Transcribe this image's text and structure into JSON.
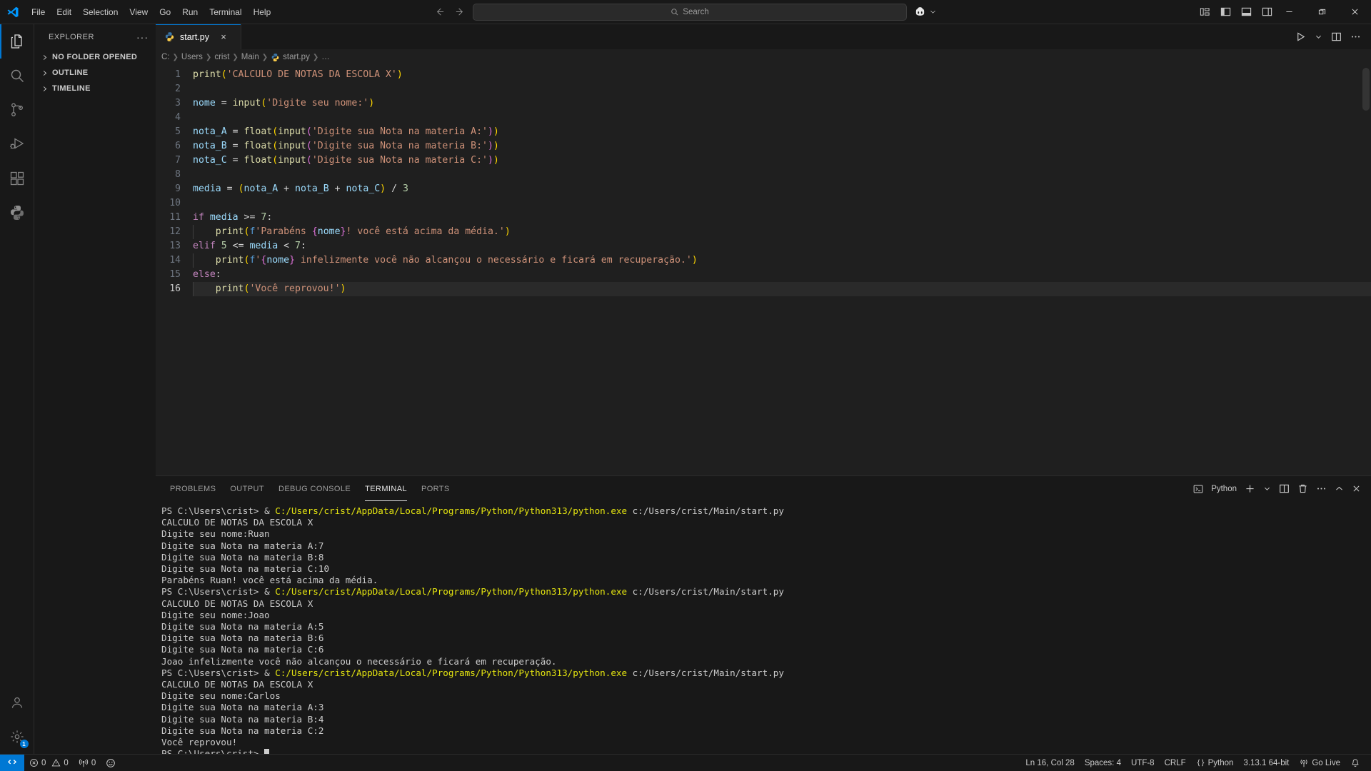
{
  "titlebar": {
    "menus": [
      "File",
      "Edit",
      "Selection",
      "View",
      "Go",
      "Run",
      "Terminal",
      "Help"
    ],
    "search_placeholder": "Search",
    "search_icon": "search-icon",
    "back_icon": "back-arrow-icon",
    "forward_icon": "forward-arrow-icon",
    "copilot_icon": "copilot-icon",
    "layout_icons": [
      "customize-layout-icon",
      "toggle-primary-sidebar-icon",
      "toggle-panel-icon",
      "toggle-secondary-sidebar-icon"
    ],
    "window_controls": [
      "minimize",
      "restore",
      "close"
    ]
  },
  "activitybar": {
    "items": [
      {
        "name": "explorer",
        "icon": "files-icon",
        "active": true
      },
      {
        "name": "search",
        "icon": "search-icon",
        "active": false
      },
      {
        "name": "source-control",
        "icon": "source-control-icon",
        "active": false
      },
      {
        "name": "run-and-debug",
        "icon": "run-debug-icon",
        "active": false
      },
      {
        "name": "extensions",
        "icon": "extensions-icon",
        "active": false
      },
      {
        "name": "python",
        "icon": "python-icon",
        "active": false
      }
    ],
    "bottom": [
      {
        "name": "accounts",
        "icon": "account-icon",
        "badge": null
      },
      {
        "name": "manage",
        "icon": "gear-icon",
        "badge": "1"
      }
    ]
  },
  "sidebar": {
    "title": "EXPLORER",
    "more_label": "···",
    "sections": [
      "NO FOLDER OPENED",
      "OUTLINE",
      "TIMELINE"
    ]
  },
  "editor": {
    "tab": {
      "label": "start.py",
      "icon": "python-file-icon",
      "close": "×"
    },
    "actions": [
      "run-python-file-icon",
      "chevron-down-icon",
      "split-editor-icon",
      "more-actions-icon"
    ],
    "breadcrumb": [
      "C:",
      "Users",
      "crist",
      "Main",
      "start.py",
      "…"
    ],
    "breadcrumb_file_icon": "python-file-icon",
    "cursor_line": 16,
    "lines": [
      {
        "n": 1,
        "text": "print('CALCULO DE NOTAS DA ESCOLA X')"
      },
      {
        "n": 2,
        "text": ""
      },
      {
        "n": 3,
        "text": "nome = input('Digite seu nome:')"
      },
      {
        "n": 4,
        "text": ""
      },
      {
        "n": 5,
        "text": "nota_A = float(input('Digite sua Nota na materia A:'))"
      },
      {
        "n": 6,
        "text": "nota_B = float(input('Digite sua Nota na materia B:'))"
      },
      {
        "n": 7,
        "text": "nota_C = float(input('Digite sua Nota na materia C:'))"
      },
      {
        "n": 8,
        "text": ""
      },
      {
        "n": 9,
        "text": "media = (nota_A + nota_B + nota_C) / 3"
      },
      {
        "n": 10,
        "text": ""
      },
      {
        "n": 11,
        "text": "if media >= 7:"
      },
      {
        "n": 12,
        "text": "    print(f'Parabéns {nome}! você está acima da média.')"
      },
      {
        "n": 13,
        "text": "elif 5 <= media < 7:"
      },
      {
        "n": 14,
        "text": "    print(f'{nome} infelizmente você não alcançou o necessário e ficará em recuperação.')"
      },
      {
        "n": 15,
        "text": "else:"
      },
      {
        "n": 16,
        "text": "    print('Você reprovou!')"
      }
    ]
  },
  "panel": {
    "tabs": [
      "PROBLEMS",
      "OUTPUT",
      "DEBUG CONSOLE",
      "TERMINAL",
      "PORTS"
    ],
    "active_tab": "TERMINAL",
    "terminal_name": "Python",
    "terminal_icon": "terminal-python-icon",
    "actions": [
      "new-terminal-icon",
      "chevron-down-icon",
      "split-terminal-icon",
      "kill-terminal-icon",
      "views-and-more-icon",
      "maximize-panel-icon",
      "close-panel-icon"
    ],
    "prompt": "PS C:\\Users\\crist> ",
    "command_amp": "& ",
    "command_path": "C:/Users/crist/AppData/Local/Programs/Python/Python313/python.exe",
    "command_arg": " c:/Users/crist/Main/start.py",
    "output_blocks": [
      [
        "CALCULO DE NOTAS DA ESCOLA X",
        "Digite seu nome:Ruan",
        "Digite sua Nota na materia A:7",
        "Digite sua Nota na materia B:8",
        "Digite sua Nota na materia C:10",
        "Parabéns Ruan! você está acima da média."
      ],
      [
        "CALCULO DE NOTAS DA ESCOLA X",
        "Digite seu nome:Joao",
        "Digite sua Nota na materia A:5",
        "Digite sua Nota na materia B:6",
        "Digite sua Nota na materia C:6",
        "Joao infelizmente você não alcançou o necessário e ficará em recuperação."
      ],
      [
        "CALCULO DE NOTAS DA ESCOLA X",
        "Digite seu nome:Carlos",
        "Digite sua Nota na materia A:3",
        "Digite sua Nota na materia B:4",
        "Digite sua Nota na materia C:2",
        "Você reprovou!"
      ]
    ]
  },
  "statusbar": {
    "remote_icon": "remote-window-icon",
    "errors": "0",
    "warnings": "0",
    "ports": "0",
    "error_icon": "error-icon",
    "warning_icon": "warning-icon",
    "ports_icon": "radio-tower-icon",
    "smiley_icon": "feedback-smiley-icon",
    "cursor_position": "Ln 16, Col 28",
    "indentation": "Spaces: 4",
    "encoding": "UTF-8",
    "eol": "CRLF",
    "language": "Python",
    "language_icon": "braces-icon",
    "interpreter": "3.13.1 64-bit",
    "golive": "Go Live",
    "golive_icon": "broadcast-icon",
    "bell_icon": "bell-icon"
  },
  "colors": {
    "accent": "#0078d4",
    "titlebar_bg": "#181818",
    "editor_bg": "#1f1f1f",
    "string": "#ce9178",
    "keyword": "#c586c0",
    "function": "#dcdcaa",
    "variable": "#9cdcfe",
    "number": "#b5cea8",
    "terminal_path": "#e5e510"
  }
}
